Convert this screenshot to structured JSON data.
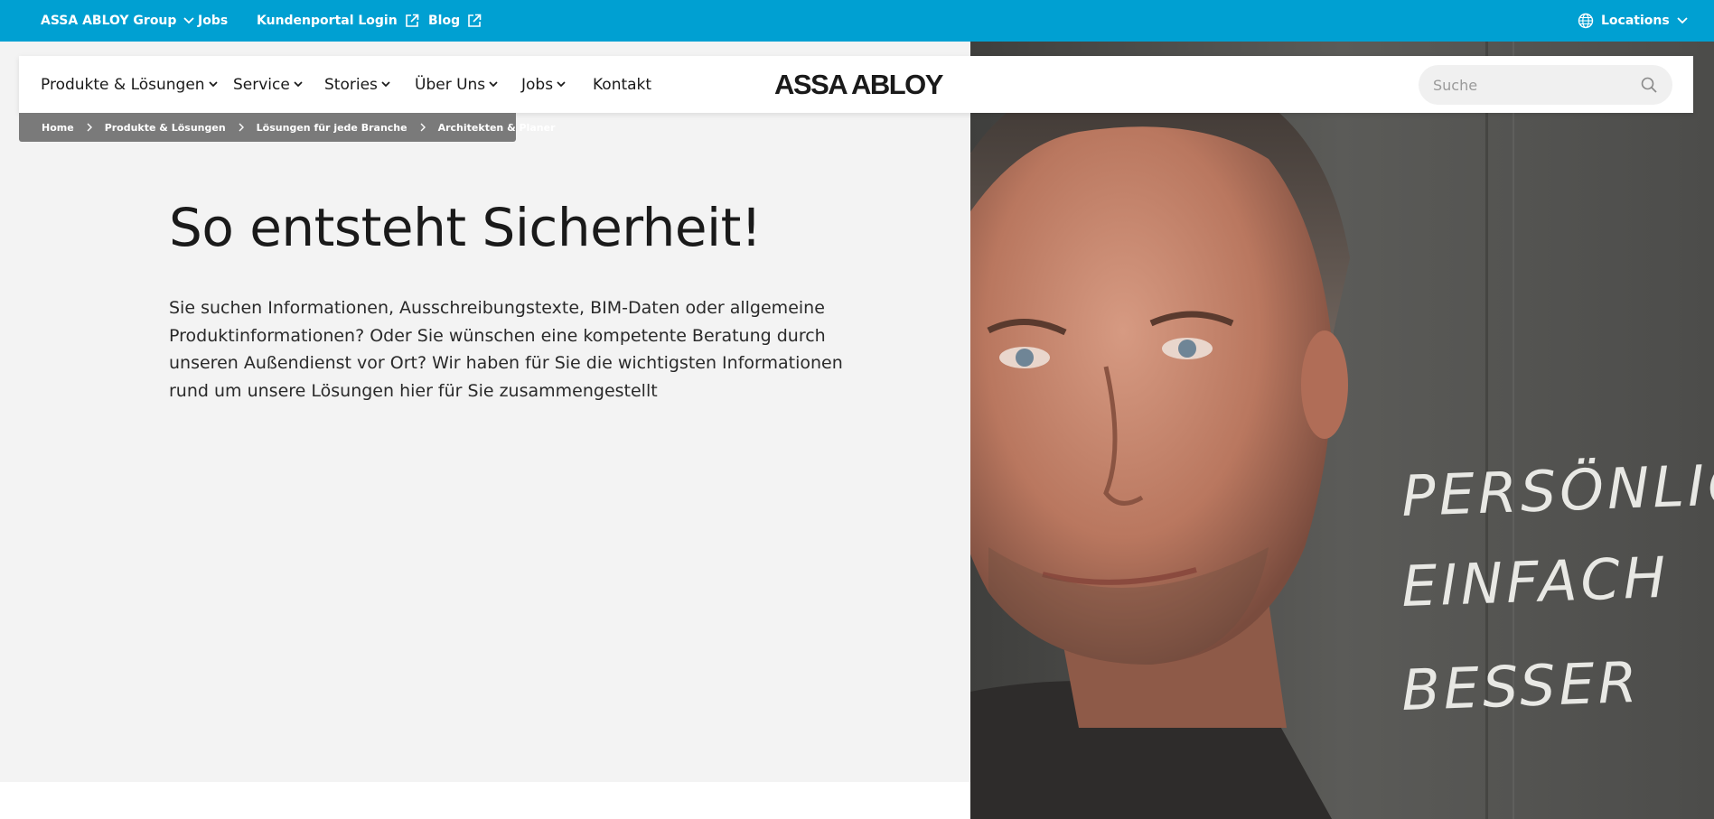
{
  "topbar": {
    "group_label": "ASSA ABLOY Group",
    "jobs_label": "Jobs",
    "portal_label": "Kundenportal Login",
    "blog_label": "Blog",
    "locations_label": "Locations",
    "background": "#00a0d2"
  },
  "nav": {
    "items": [
      {
        "label": "Produkte & Lösungen"
      },
      {
        "label": "Service"
      },
      {
        "label": "Stories"
      },
      {
        "label": "Über Uns"
      },
      {
        "label": "Jobs"
      },
      {
        "label": "Kontakt"
      }
    ],
    "logo_text": "ASSA ABLOY",
    "search_placeholder": "Suche"
  },
  "breadcrumb": [
    {
      "label": "Home"
    },
    {
      "label": "Produkte & Lösungen"
    },
    {
      "label": "Lösungen für jede Branche"
    },
    {
      "label": "Architekten & Planer"
    }
  ],
  "hero": {
    "title": "So entsteht Sicherheit!",
    "lead": "Sie suchen Informationen, Ausschreibungstexte, BIM-Daten oder allgemeine Produktinformationen? Oder Sie wünschen eine kompetente Beratung durch unseren Außendienst vor Ort? Wir haben für Sie die wichtigsten Informationen rund um unsere Lösungen hier für Sie zusammengestellt",
    "chalk_lines": [
      "PERSÖNLIC",
      "EINFACH",
      "BESSER"
    ]
  }
}
